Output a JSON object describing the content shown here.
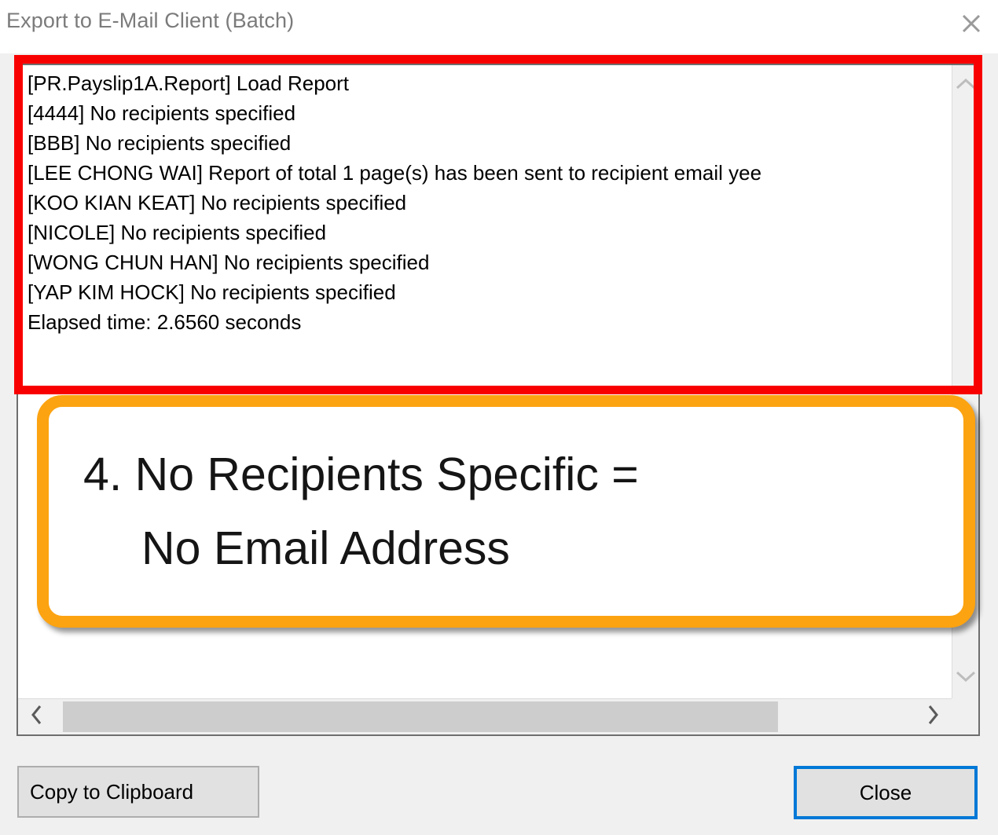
{
  "window": {
    "title": "Export to E-Mail Client (Batch)",
    "close_icon": "close-x-icon"
  },
  "log": {
    "lines": [
      "[PR.Payslip1A.Report] Load Report",
      "[4444] No recipients specified",
      "[BBB] No recipients specified",
      "[LEE CHONG WAI] Report of total 1 page(s) has been sent to recipient email yee",
      "[KOO KIAN KEAT] No recipients specified",
      "[NICOLE] No recipients specified",
      "[WONG CHUN HAN] No recipients specified",
      "[YAP KIM HOCK] No recipients specified",
      "Elapsed time:    2.6560 seconds"
    ],
    "vertical_scrollbar": {
      "up_icon": "chevron-up-icon",
      "down_icon": "chevron-down-icon"
    },
    "horizontal_scrollbar": {
      "left_icon": "chevron-left-icon",
      "right_icon": "chevron-right-icon"
    }
  },
  "buttons": {
    "copy_to_clipboard": "Copy to Clipboard",
    "close": "Close"
  },
  "annotations": {
    "red_highlight": {
      "color": "#f90000",
      "target": "log-output-area"
    },
    "orange_callout": {
      "color": "#fca311",
      "line1": "4. No Recipients Specific =",
      "line2": "No Email Address"
    }
  }
}
